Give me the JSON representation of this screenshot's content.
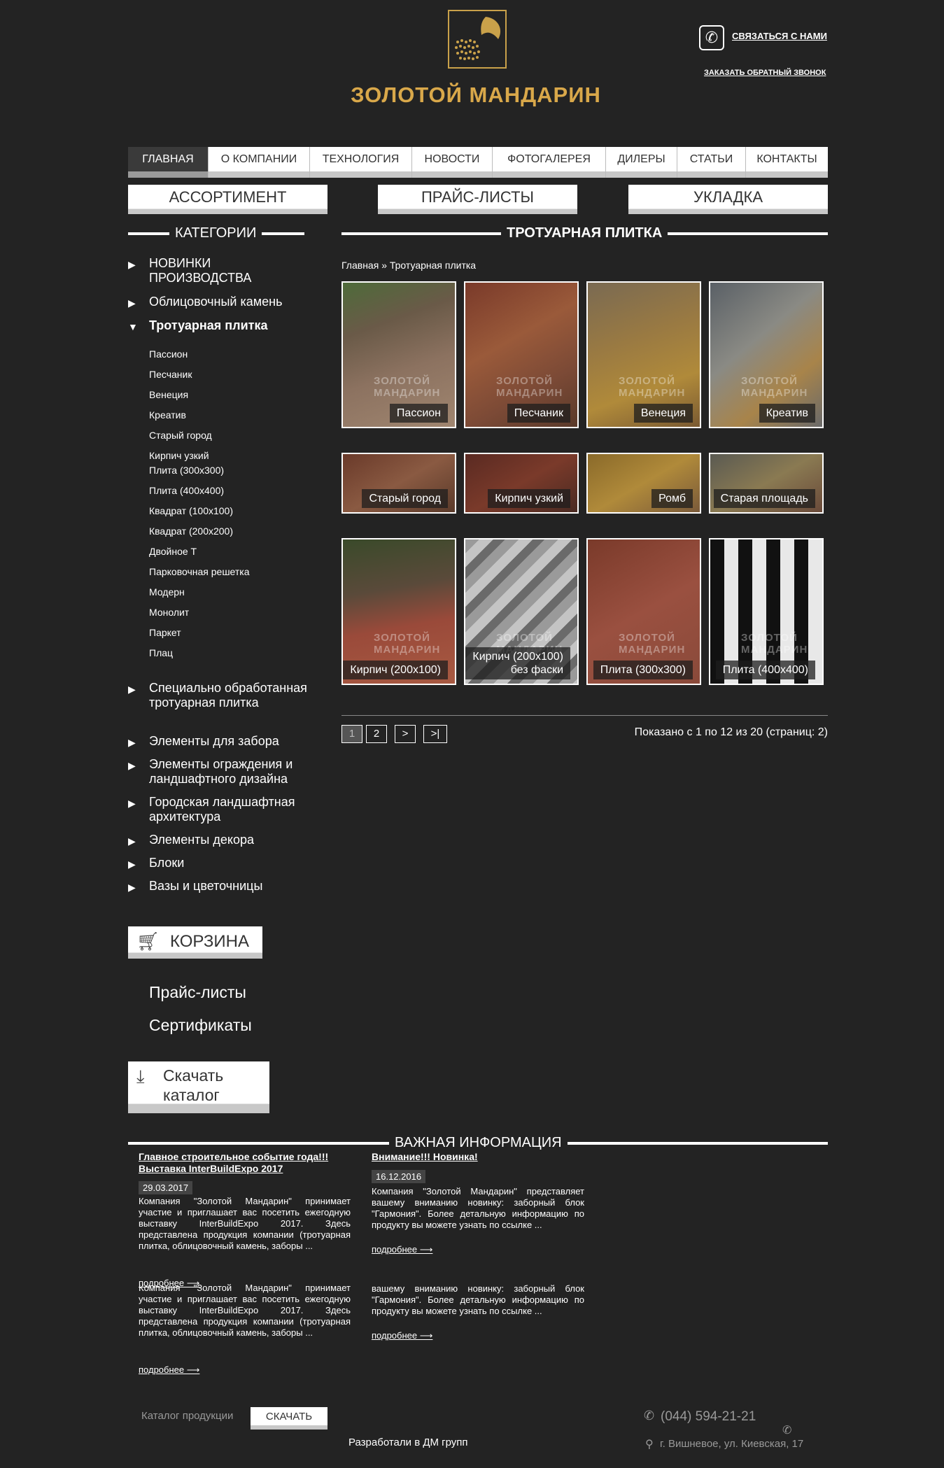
{
  "header": {
    "logo_text": "ЗОЛОТОЙ МАНДАРИН",
    "contact_label": "связаться с нами",
    "callback_label": "заказать обратный звонок"
  },
  "nav": [
    "ГЛАВНАЯ",
    "О КОМПАНИИ",
    "ТЕХНОЛОГИЯ",
    "НОВОСТИ",
    "ФОТОГАЛЕРЕЯ",
    "ДИЛЕРЫ",
    "СТАТЬИ",
    "КОНТАКТЫ"
  ],
  "big_buttons": [
    "АССОРТИМЕНТ",
    "ПРАЙС-ЛИСТЫ",
    "УКЛАДКА"
  ],
  "sidebar": {
    "title": "КАТЕГОРИИ",
    "categories_top": [
      "НОВИНКИ ПРОИЗВОДСТВА",
      "Облицовочный камень",
      "Тротуарная плитка"
    ],
    "subcategories": [
      "Пассион",
      "Песчаник",
      "Венеция",
      "Креатив",
      "Старый город",
      "Кирпич узкий",
      "Плита (300х300)",
      "Плита (400х400)",
      "Квадрат (100х100)",
      "Квадрат (200х200)",
      "Двойное Т",
      "Парковочная решетка",
      "Модерн",
      "Монолит",
      "Паркет",
      "Плац"
    ],
    "categories_bottom": [
      "Специально обработанная тротуарная плитка",
      "Элементы для забора",
      "Элементы ограждения и ландшафтного дизайна",
      "Городская ландшафтная архитектура",
      "Элементы декора",
      "Блоки",
      "Вазы и цветочницы"
    ],
    "cart_label": "КОРЗИНА",
    "links": [
      "Прайс-листы",
      "Сертификаты"
    ],
    "download_label": "Скачать каталог"
  },
  "main": {
    "title": "ТРОТУАРНАЯ ПЛИТКА",
    "breadcrumb": {
      "home": "Главная",
      "sep": "»",
      "current": "Тротуарная плитка"
    },
    "watermark": "ЗОЛОТОЙ МАНДАРИН",
    "products": [
      "Пассион",
      "Песчаник",
      "Венеция",
      "Креатив",
      "Старый город",
      "Кирпич узкий",
      "Ромб",
      "Старая площадь",
      "Кирпич (200х100)",
      "Кирпич (200х100) без фаски",
      "Плита (300х300)",
      "Плита (400х400)"
    ],
    "pager": [
      "1",
      "2",
      ">",
      ">|"
    ],
    "pager_info": "Показано с 1 по 12 из 20 (страниц: 2)"
  },
  "news": {
    "title": "ВАЖНАЯ ИНФОРМАЦИЯ",
    "items": [
      {
        "title": "Главное строительное событие года!!! Выставка InterBuildExpo 2017",
        "date": "29.03.2017",
        "body": "Компания \"Золотой Мандарин\" принимает участие и приглашает вас посетить ежегодную выставку InterBuildExpo 2017. Здесь представлена продукция компании (тротуарная плитка, облицовочный камень, заборы ...",
        "more": "подробнее ⟶"
      },
      {
        "title": "Внимание!!! Новинка!",
        "date": "16.12.2016",
        "body": "Компания \"Золотой Мандарин\" представляет вашему вниманию новинку: заборный блок \"Гармония\". Более детальную информацию по продукту вы можете узнать по ссылке ...",
        "more": "подробнее ⟶"
      }
    ],
    "dup_left_body": "Компания \"Золотой Мандарин\" принимает участие и приглашает вас посетить ежегодную выставку InterBuildExpo 2017. Здесь представлена продукция компании (тротуарная плитка, облицовочный камень, заборы ...",
    "dup_right_body": "вашему вниманию новинку: заборный блок \"Гармония\". Более детальную информацию по продукту вы можете узнать по ссылке ...",
    "more": "подробнее ⟶"
  },
  "footer": {
    "catalog_label": "Каталог продукции",
    "download_btn": "СКАЧАТЬ",
    "phone": "(044) 594-21-21",
    "address": "г. Вишневое, ул. Киевская, 17",
    "dev_link": "Разработали в ДМ групп"
  }
}
